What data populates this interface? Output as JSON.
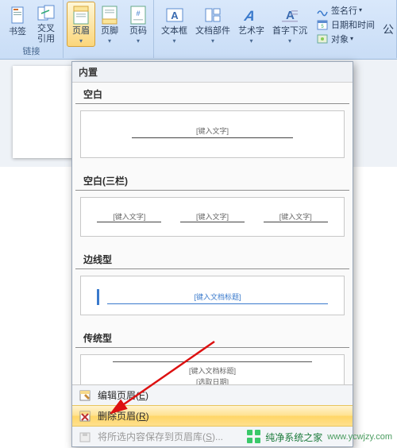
{
  "ribbon": {
    "groups": {
      "links": {
        "label": "链接",
        "bookmark": "书签",
        "crossref": "交叉\n引用"
      },
      "headerfooter": {
        "header": "页眉",
        "footer": "页脚",
        "pagenum": "页码"
      },
      "text": {
        "textbox": "文本框",
        "parts": "文档部件",
        "wordart": "艺术字",
        "dropcap": "首字下沉",
        "signature": "签名行",
        "datetime": "日期和时间",
        "object": "对象"
      }
    },
    "truncated": "公"
  },
  "dropdown": {
    "header": "内置",
    "sections": {
      "blank": {
        "title": "空白",
        "placeholder": "[键入文字]"
      },
      "blank3": {
        "title": "空白(三栏)",
        "placeholder": "[键入文字]"
      },
      "sideline": {
        "title": "边线型",
        "placeholder": "[键入文档标题]"
      },
      "traditional": {
        "title": "传统型",
        "placeholder1": "[键入文档标题]",
        "placeholder2": "[选取日期]"
      }
    },
    "footer": {
      "edit": "编辑页眉(",
      "edit_key": "E",
      "edit_end": ")",
      "remove": "删除页眉(",
      "remove_key": "R",
      "remove_end": ")",
      "save": "将所选内容保存到页眉库(",
      "save_key": "S",
      "save_end": ")..."
    }
  },
  "watermark": {
    "text": "纯净系统之家",
    "url": "www.ycwjzy.com"
  }
}
